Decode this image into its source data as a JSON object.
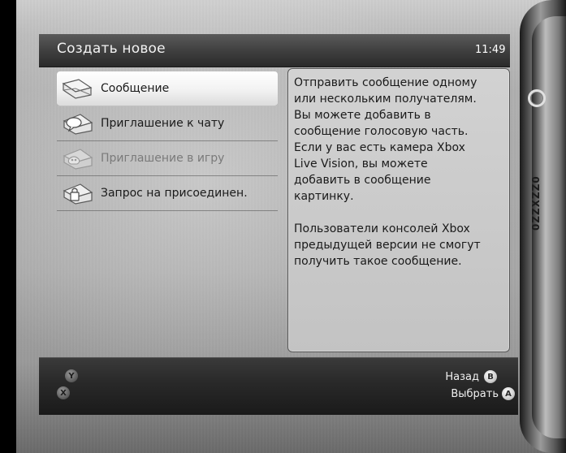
{
  "header": {
    "title": "Создать новое",
    "time": "11:49"
  },
  "menu": {
    "items": [
      {
        "label": "Сообщение",
        "icon": "envelope-icon",
        "state": "selected"
      },
      {
        "label": "Приглашение к чату",
        "icon": "chat-invite-icon",
        "state": "normal"
      },
      {
        "label": "Приглашение в игру",
        "icon": "game-invite-icon",
        "state": "disabled"
      },
      {
        "label": "Запрос на присоединен.",
        "icon": "join-request-icon",
        "state": "normal"
      }
    ]
  },
  "description": {
    "text": "Отправить сообщение одному\nили нескольким получателям.\nВы можете добавить в\nсообщение голосовую часть.\nЕсли у вас есть камера Xbox\nLive Vision, вы можете\nдобавить в сообщение\nкартинку.\n\nПользователи консолей Xbox\nпредыдущей версии не смогут\nполучить такое сообщение."
  },
  "side": {
    "vertical_label": "0ZZXZZ0"
  },
  "footer": {
    "y_button": "Y",
    "x_button": "X",
    "back": {
      "label": "Назад",
      "button": "B"
    },
    "select": {
      "label": "Выбрать",
      "button": "A"
    }
  }
}
